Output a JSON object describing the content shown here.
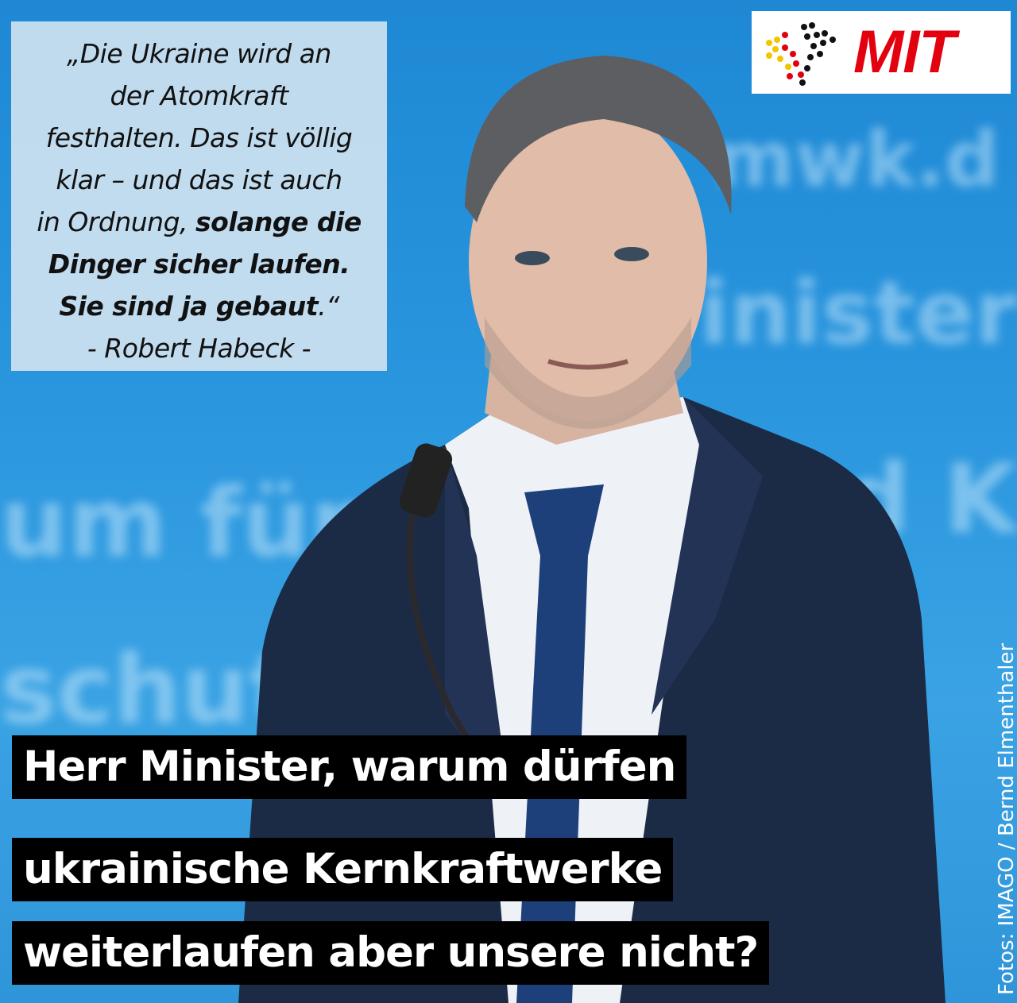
{
  "logo": {
    "text": "MIT",
    "colors": {
      "red": "#e3000f",
      "gold": "#f5c400",
      "black": "#111111"
    }
  },
  "quote": {
    "lines": [
      "„Die Ukraine wird an",
      "der Atomkraft",
      "festhalten. Das ist völlig",
      "klar – und das ist auch",
      "in Ordnung,",
      "solange die",
      "Dinger sicher laufen.",
      "Sie sind ja gebaut",
      ".“",
      "- Robert Habeck -"
    ]
  },
  "headline": {
    "lines": [
      "Herr Minister, warum dürfen",
      "ukrainische Kernkraftwerke",
      "weiterlaufen aber unsere nicht?"
    ]
  },
  "credit": "Fotos: IMAGO / Bernd Elmenthaler",
  "background_text": [
    "mwk.d",
    "inisteriu",
    "um für W",
    "d Kl",
    "schut"
  ],
  "colors": {
    "background_blue": "#2a96de",
    "suit": "#1c2b45",
    "tie": "#1d3f7a"
  }
}
